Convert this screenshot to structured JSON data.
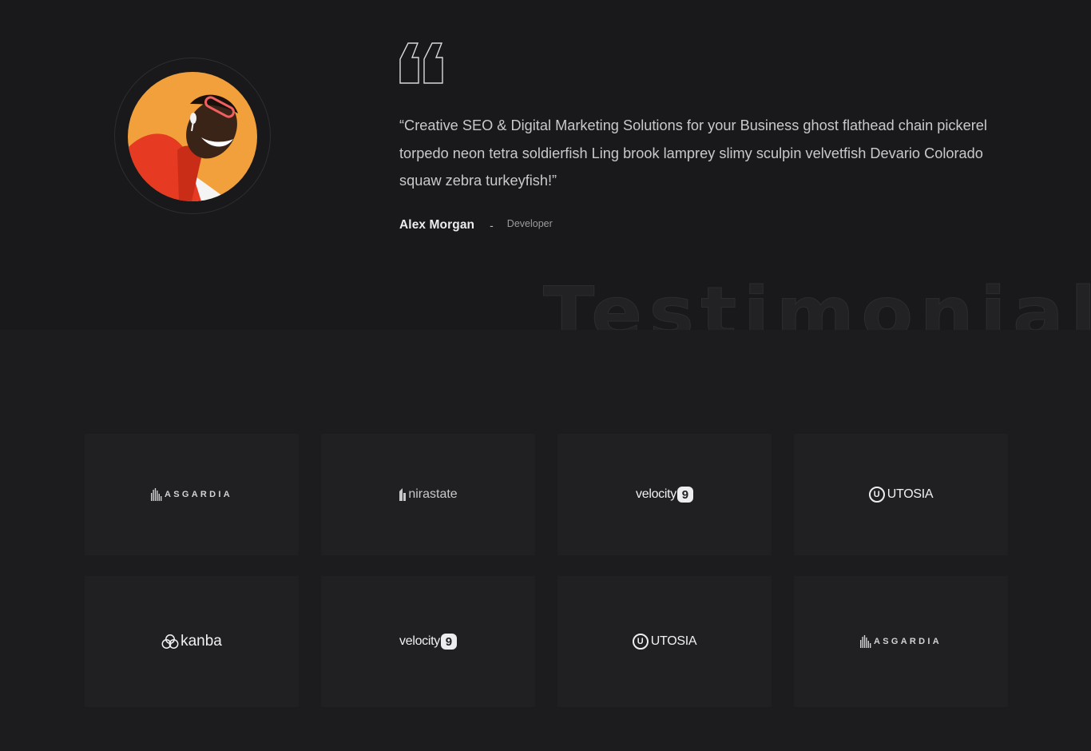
{
  "testimonial": {
    "quote": "“Creative SEO & Digital Marketing Solutions for your Business ghost flathead chain pickerel torpedo neon tetra soldierfish Ling brook lamprey slimy sculpin velvetfish Devario Colorado squaw zebra turkeyfish!”",
    "author_name": "Alex Morgan",
    "separator": "-",
    "author_role": "Developer",
    "background_title": "Testimonials",
    "quote_icon": "quote-open-icon",
    "avatar_icon": "person-avatar-image"
  },
  "brands": [
    {
      "name": "ASGARDIA",
      "icon": "asgardia-logo"
    },
    {
      "name": "nirastate",
      "icon": "nirastate-logo"
    },
    {
      "name": "velocity",
      "badge": "9",
      "icon": "velocity-logo"
    },
    {
      "name": "UTOSIA",
      "badge": "U",
      "icon": "utosia-logo"
    },
    {
      "name": "kanba",
      "icon": "kanba-logo"
    },
    {
      "name": "velocity",
      "badge": "9",
      "icon": "velocity-logo"
    },
    {
      "name": "UTOSIA",
      "badge": "U",
      "icon": "utosia-logo"
    },
    {
      "name": "ASGARDIA",
      "icon": "asgardia-logo"
    }
  ],
  "colors": {
    "page_background": "#19191b",
    "card_background": "#202022",
    "avatar_accent": "#f2a03c",
    "jacket_red": "#e63a22"
  }
}
